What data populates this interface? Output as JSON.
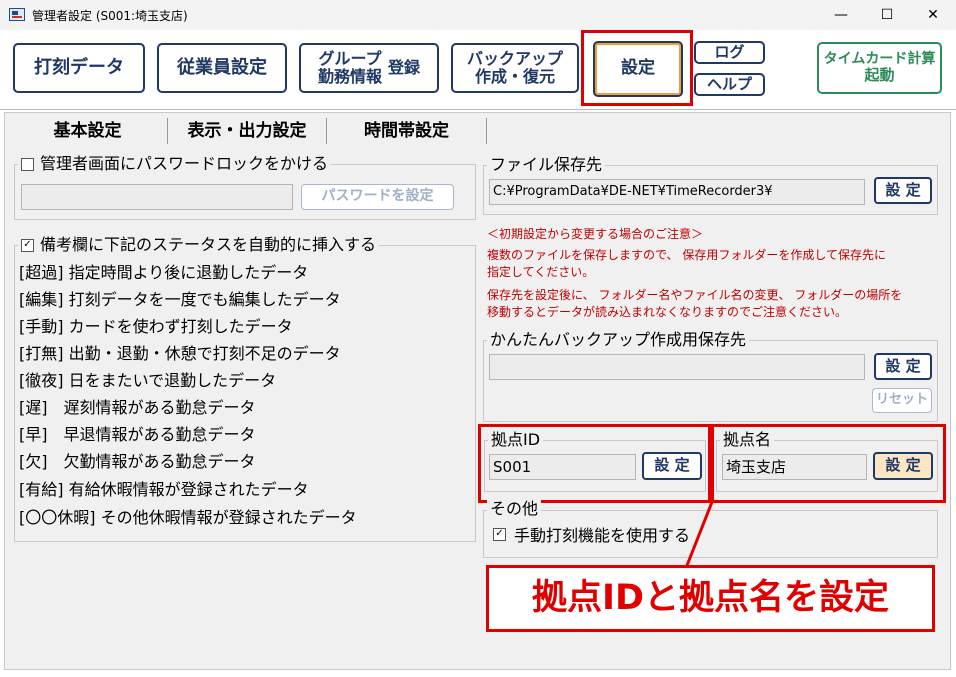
{
  "window": {
    "title": "管理者設定 (S001:埼玉支店)",
    "minimize": "—",
    "maximize": "☐",
    "close": "✕"
  },
  "toolbar": {
    "punch_data": "打刻データ",
    "employee_settings": "従業員設定",
    "group_line1": "グループ",
    "group_line2": "勤務情報",
    "group_register": "登録",
    "backup_line1": "バックアップ",
    "backup_line2": "作成・復元",
    "settings": "設定",
    "log": "ログ",
    "help": "ヘルプ",
    "timecard_line1": "タイムカード計算",
    "timecard_line2": "起動"
  },
  "tabs": [
    "基本設定",
    "表示・出力設定",
    "時間帯設定"
  ],
  "password_lock": {
    "label": "管理者画面にパスワードロックをかける",
    "checked": false,
    "field_value": "",
    "button": "パスワードを設定"
  },
  "remarks": {
    "label": "備考欄に下記のステータスを自動的に挿入する",
    "checked": true,
    "items": [
      "[超過] 指定時間より後に退勤したデータ",
      "[編集] 打刻データを一度でも編集したデータ",
      "[手動] カードを使わず打刻したデータ",
      "[打無] 出勤・退勤・休憩で打刻不足のデータ",
      "[徹夜] 日をまたいで退勤したデータ",
      "[遅]　遅刻情報がある勤怠データ",
      "[早]　早退情報がある勤怠データ",
      "[欠]　欠勤情報がある勤怠データ",
      "[有給] 有給休暇情報が登録されたデータ",
      "[〇〇休暇] その他休暇情報が登録されたデータ"
    ]
  },
  "file_save": {
    "label": "ファイル保存先",
    "path": "C:¥ProgramData¥DE-NET¥TimeRecorder3¥",
    "button": "設 定"
  },
  "notice": {
    "heading": "＜初期設定から変更する場合のご注意＞",
    "p1_line1": "複数のファイルを保存しますので、 保存用フォルダーを作成して保存先に",
    "p1_line2": "指定してください。",
    "p2_line1": "保存先を設定後に、 フォルダー名やファイル名の変更、 フォルダーの場所を",
    "p2_line2": "移動するとデータが読み込まれなくなりますのでご注意ください。"
  },
  "easy_backup": {
    "label": "かんたんバックアップ作成用保存先",
    "path": "",
    "button": "設 定",
    "reset": "リセット"
  },
  "location_id": {
    "label": "拠点ID",
    "value": "S001",
    "button": "設 定"
  },
  "location_name": {
    "label": "拠点名",
    "value": "埼玉支店",
    "button": "設 定"
  },
  "other": {
    "label": "その他",
    "manual_punch": "手動打刻機能を使用する",
    "checked": true
  },
  "callout": "拠点IDと拠点名を設定",
  "colors": {
    "accent_navy": "#1f3864",
    "highlight_red": "#e00000",
    "timecard_green": "#2e8b57",
    "notice_red": "#c00000",
    "active_button_orange": "#f0a030"
  }
}
